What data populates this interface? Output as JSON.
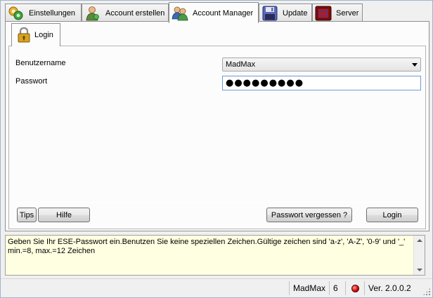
{
  "tabs": [
    {
      "label": "Einstellungen",
      "icon": "settings-icon"
    },
    {
      "label": "Account erstellen",
      "icon": "user-add-icon"
    },
    {
      "label": "Account Manager",
      "icon": "users-icon",
      "active": true
    },
    {
      "label": "Update",
      "icon": "floppy-disk-icon"
    },
    {
      "label": "Server",
      "icon": "server-icon"
    }
  ],
  "login_tab": {
    "label": "Login",
    "icon": "lock-icon"
  },
  "form": {
    "username_label": "Benutzername",
    "username_value": "MadMax",
    "password_label": "Passwort",
    "password_value": "●●●●●●●●●"
  },
  "buttons": {
    "tips": "Tips",
    "hilfe": "Hilfe",
    "forgot": "Passwort vergessen ?",
    "login": "Login"
  },
  "message": {
    "line1": "Geben Sie Ihr ESE-Passwort ein.Benutzen Sie keine speziellen Zeichen.Gültige zeichen sind 'a-z', 'A-Z', '0-9' und '_'",
    "line2": "min.=8, max.=12 Zeichen"
  },
  "status": {
    "user": "MadMax",
    "count": "6",
    "version": "Ver. 2.0.0.2",
    "led_color": "#d40000"
  }
}
